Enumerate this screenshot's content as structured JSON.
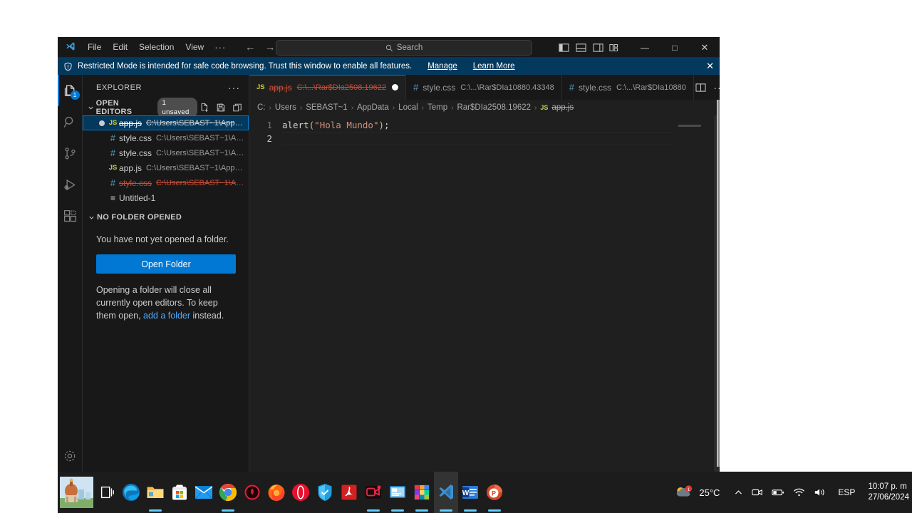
{
  "window": {
    "app": "Visual Studio Code",
    "menu": [
      "File",
      "Edit",
      "Selection",
      "View",
      "···"
    ],
    "nav": {
      "back": "←",
      "forward": "→"
    },
    "search": {
      "placeholder": "Search",
      "icon": "search-icon"
    },
    "layout_icons": [
      "toggle-primary-sidebar-icon",
      "toggle-panel-icon",
      "toggle-secondary-sidebar-icon",
      "customize-layout-icon"
    ],
    "controls": {
      "minimize": "—",
      "maximize": "□",
      "close": "✕"
    }
  },
  "banner": {
    "icon": "shield-icon",
    "text": "Restricted Mode is intended for safe code browsing. Trust this window to enable all features.",
    "manage": "Manage",
    "learn_more": "Learn More",
    "close": "✕"
  },
  "activitybar": {
    "items": [
      {
        "name": "explorer",
        "icon": "files-icon",
        "badge": "1",
        "active": true
      },
      {
        "name": "search",
        "icon": "search-icon",
        "badge": "",
        "active": false
      },
      {
        "name": "source-control",
        "icon": "source-control-icon",
        "badge": "",
        "active": false
      },
      {
        "name": "run-and-debug",
        "icon": "run-debug-icon",
        "badge": "",
        "active": false
      },
      {
        "name": "extensions",
        "icon": "extensions-icon",
        "badge": "",
        "active": false
      }
    ],
    "bottom": {
      "name": "manage",
      "icon": "gear-icon"
    }
  },
  "sidebar": {
    "title": "EXPLORER",
    "more_actions": "···",
    "open_editors": {
      "label": "OPEN EDITORS",
      "badge": "1 unsaved",
      "actions": [
        "new-untitled-file-icon",
        "save-all-icon",
        "close-all-editors-icon"
      ],
      "items": [
        {
          "icon": "js-file-icon",
          "icon_glyph": "JS",
          "name": "app.js",
          "path": "C:\\Users\\SEBAST~1\\AppDa...",
          "dirty": true,
          "deleted": true,
          "selected": true
        },
        {
          "icon": "css-file-icon",
          "icon_glyph": "#",
          "name": "style.css",
          "path": "C:\\Users\\SEBAST~1\\App...",
          "dirty": false,
          "deleted": false,
          "selected": false
        },
        {
          "icon": "css-file-icon",
          "icon_glyph": "#",
          "name": "style.css",
          "path": "C:\\Users\\SEBAST~1\\App...",
          "dirty": false,
          "deleted": false,
          "selected": false
        },
        {
          "icon": "js-file-icon",
          "icon_glyph": "JS",
          "name": "app.js",
          "path": "C:\\Users\\SEBAST~1\\AppDa...",
          "dirty": false,
          "deleted": false,
          "selected": false
        },
        {
          "icon": "css-file-icon",
          "icon_glyph": "#",
          "name": "style.css",
          "path": "C:\\Users\\SEBAST~1\\App...",
          "dirty": false,
          "deleted": true,
          "selected": false
        },
        {
          "icon": "untitled-file-icon",
          "icon_glyph": "≡",
          "name": "Untitled-1",
          "path": "",
          "dirty": false,
          "deleted": false,
          "selected": false
        }
      ]
    },
    "no_folder": {
      "label": "NO FOLDER OPENED",
      "message": "You have not yet opened a folder.",
      "button": "Open Folder",
      "note_before": "Opening a folder will close all currently open editors. To keep them open, ",
      "note_link": "add a folder",
      "note_after": " instead."
    }
  },
  "tabs": [
    {
      "icon": "js-file-icon",
      "icon_glyph": "JS",
      "name": "app.js",
      "path": "C:\\...\\Rar$DIa2508.19622",
      "active": true,
      "dirty": true,
      "deleted": true
    },
    {
      "icon": "css-file-icon",
      "icon_glyph": "#",
      "name": "style.css",
      "path": "C:\\...\\Rar$DIa10880.43348",
      "active": false,
      "dirty": false,
      "deleted": false
    },
    {
      "icon": "css-file-icon",
      "icon_glyph": "#",
      "name": "style.css",
      "path": "C:\\...\\Rar$DIa10880",
      "active": false,
      "dirty": false,
      "deleted": false
    }
  ],
  "tabbar_actions": [
    "split-editor-icon",
    "more-actions-icon"
  ],
  "breadcrumbs": {
    "segments": [
      "C:",
      "Users",
      "SEBAST~1",
      "AppData",
      "Local",
      "Temp",
      "Rar$DIa2508.19622"
    ],
    "separator": "›",
    "file": {
      "icon": "js-file-icon",
      "icon_glyph": "JS",
      "name": "app.js"
    }
  },
  "editor": {
    "line_numbers": [
      "1",
      "2"
    ],
    "current_line": 2,
    "code": [
      {
        "tokens": [
          {
            "text": "alert",
            "type": "function"
          },
          {
            "text": "(",
            "type": "paren"
          },
          {
            "text": "\"Hola Mundo\"",
            "type": "string"
          },
          {
            "text": ")",
            "type": "paren"
          },
          {
            "text": ";",
            "type": "punctuation"
          }
        ]
      },
      {
        "tokens": []
      }
    ]
  },
  "taskbar": {
    "start": "start-button",
    "items": [
      {
        "name": "task-view",
        "icon": "task-view-icon",
        "running": false
      },
      {
        "name": "microsoft-edge",
        "icon": "edge-icon",
        "running": false
      },
      {
        "name": "file-explorer",
        "icon": "folder-icon",
        "running": true
      },
      {
        "name": "microsoft-store",
        "icon": "store-icon",
        "running": false
      },
      {
        "name": "mail",
        "icon": "mail-icon",
        "running": false
      },
      {
        "name": "google-chrome",
        "icon": "chrome-icon",
        "running": true
      },
      {
        "name": "app-red-circle",
        "icon": "red-ring-icon",
        "running": false
      },
      {
        "name": "firefox",
        "icon": "firefox-icon",
        "running": false
      },
      {
        "name": "opera",
        "icon": "opera-icon",
        "running": false
      },
      {
        "name": "security-shield-app",
        "icon": "shield-app-icon",
        "running": false
      },
      {
        "name": "adobe-acrobat",
        "icon": "acrobat-icon",
        "running": false
      },
      {
        "name": "screen-recorder",
        "icon": "camera-record-icon",
        "running": true
      },
      {
        "name": "remote-desktop",
        "icon": "remote-desktop-icon",
        "running": true
      },
      {
        "name": "colorful-app",
        "icon": "colorful-grid-icon",
        "running": true
      },
      {
        "name": "visual-studio-code",
        "icon": "vscode-icon",
        "running": true,
        "active": true
      },
      {
        "name": "microsoft-word",
        "icon": "word-icon",
        "running": true
      },
      {
        "name": "microsoft-powerpoint",
        "icon": "powerpoint-icon",
        "running": true
      }
    ],
    "tray": {
      "weather_icon": "weather-cloud-icon",
      "weather_badge": "1",
      "temperature": "25°C",
      "chevron": "⌃",
      "icons": [
        "camera-icon",
        "battery-icon",
        "wifi-icon",
        "volume-icon"
      ],
      "language": "ESP",
      "time": "10:07 p. m",
      "date": "27/06/2024"
    }
  }
}
